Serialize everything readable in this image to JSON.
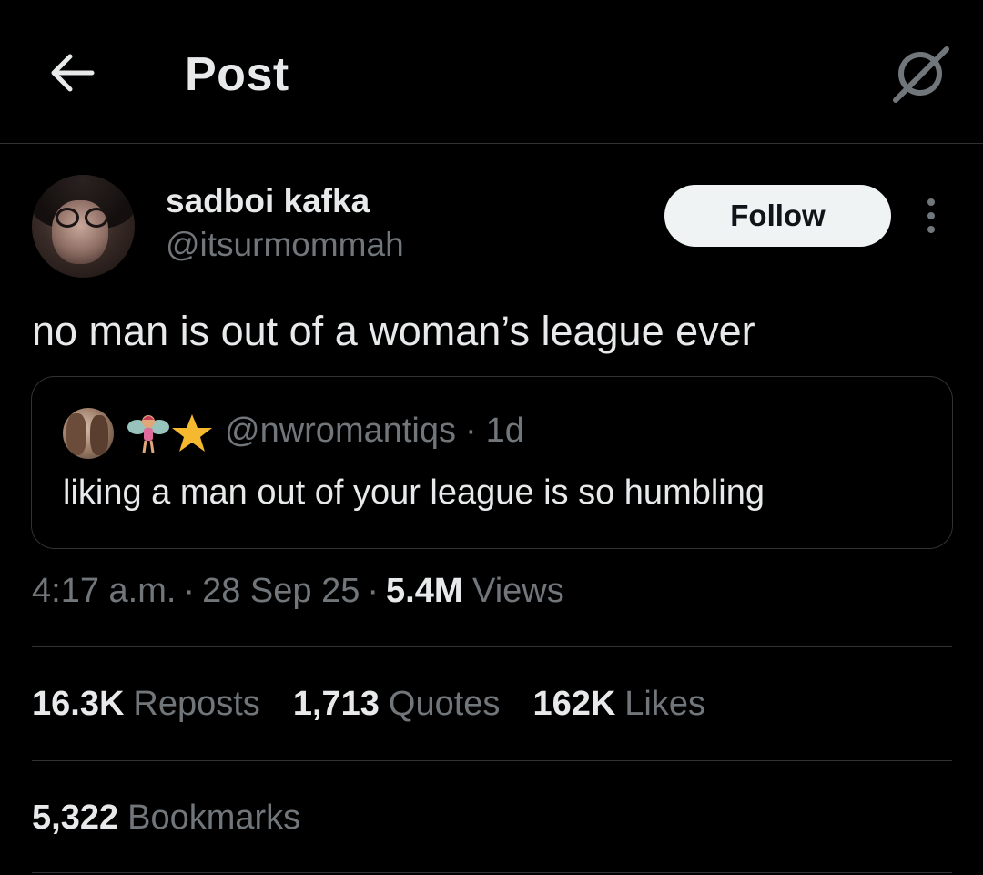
{
  "header": {
    "title": "Post",
    "back_icon": "arrow-left-icon",
    "grok_icon": "grok-icon"
  },
  "author": {
    "display_name": "sadboi kafka",
    "handle": "@itsurmommah",
    "follow_label": "Follow",
    "more_icon": "more-vertical-icon"
  },
  "tweet": {
    "text": "no man is out of a woman’s league ever"
  },
  "quote": {
    "emoji": "🧚⭐",
    "handle": "@nwromantiqs",
    "separator": "·",
    "age": "1d",
    "text": "liking a man out of your league is so humbling"
  },
  "meta": {
    "time": "4:17 a.m.",
    "date": "28 Sep 25",
    "separator": "·",
    "views_count": "5.4M",
    "views_label": "Views"
  },
  "stats": [
    {
      "count": "16.3K",
      "label": "Reposts"
    },
    {
      "count": "1,713",
      "label": "Quotes"
    },
    {
      "count": "162K",
      "label": "Likes"
    }
  ],
  "bookmarks": {
    "count": "5,322",
    "label": "Bookmarks"
  },
  "colors": {
    "background": "#000000",
    "text_primary": "#e7e9ea",
    "text_secondary": "#71767b",
    "border": "#2f3336",
    "follow_bg": "#eff3f4",
    "follow_text": "#0f1419"
  }
}
